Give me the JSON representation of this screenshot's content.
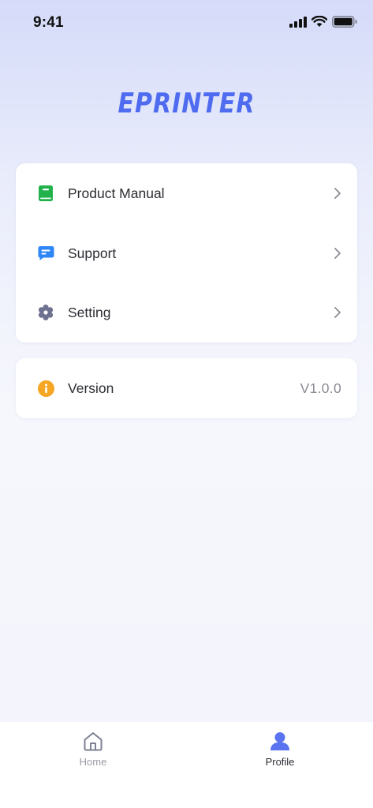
{
  "status_bar": {
    "time": "9:41"
  },
  "brand": {
    "logo_text": "EPRINTER",
    "accent_color": "#4f6cf0"
  },
  "menu": {
    "items": [
      {
        "label": "Product Manual",
        "icon": "book-icon",
        "icon_color": "#22b24c"
      },
      {
        "label": "Support",
        "icon": "chat-icon",
        "icon_color": "#2f86f6"
      },
      {
        "label": "Setting",
        "icon": "gear-icon",
        "icon_color": "#6e7290"
      }
    ]
  },
  "version": {
    "label": "Version",
    "value": "V1.0.0",
    "icon": "info-icon",
    "icon_color": "#f5a623"
  },
  "tab_bar": {
    "tabs": [
      {
        "label": "Home",
        "icon": "home-icon",
        "active": false
      },
      {
        "label": "Profile",
        "icon": "user-icon",
        "active": true
      }
    ],
    "active_color": "#5a73f0",
    "inactive_color": "#9a9ca4"
  }
}
